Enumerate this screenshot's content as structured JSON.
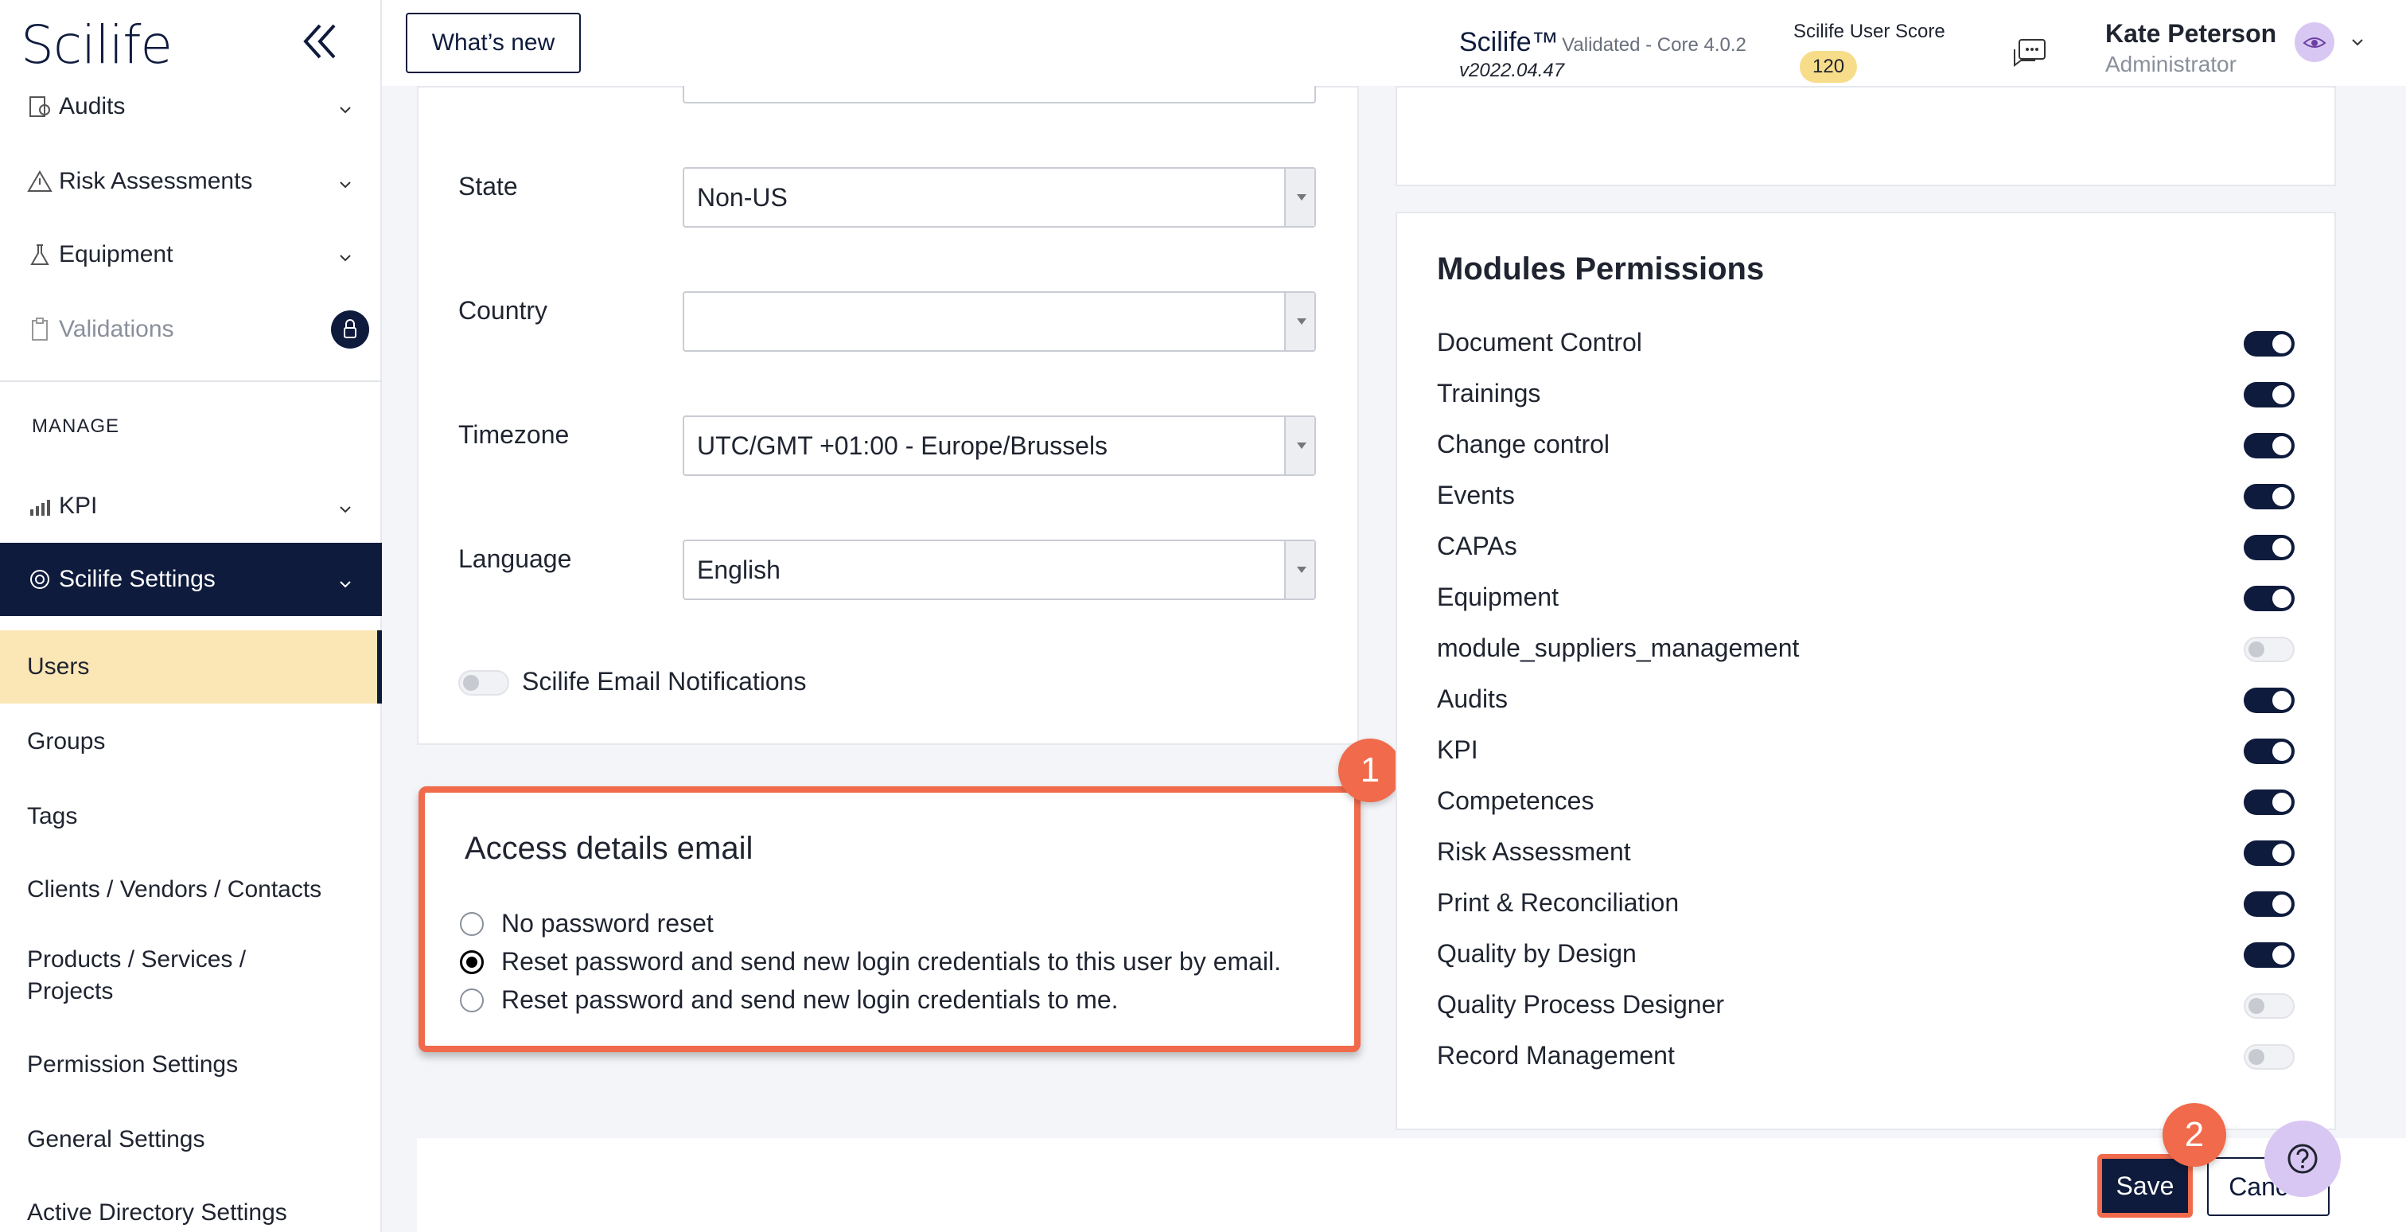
{
  "app": {
    "logo": "Scilife"
  },
  "sidebar": {
    "items": [
      {
        "label": "Audits"
      },
      {
        "label": "Risk Assessments"
      },
      {
        "label": "Equipment"
      },
      {
        "label": "Validations"
      }
    ],
    "section_manage": "MANAGE",
    "kpi": "KPI",
    "settings": "Scilife Settings",
    "sub_items": [
      {
        "label": "Users"
      },
      {
        "label": "Groups"
      },
      {
        "label": "Tags"
      },
      {
        "label": "Clients / Vendors / Contacts"
      },
      {
        "label": "Products / Services /",
        "label2": "Projects"
      },
      {
        "label": "Permission Settings"
      },
      {
        "label": "General Settings"
      },
      {
        "label": "Active Directory Settings"
      }
    ]
  },
  "header": {
    "whats_new": "What’s new",
    "brand": "Scilife™",
    "validated": "Validated - Core 4.0.2",
    "version": "v2022.04.47",
    "score_label": "Scilife User Score",
    "score_value": "120",
    "user_name": "Kate Peterson",
    "user_role": "Administrator"
  },
  "form": {
    "state_label": "State",
    "state_value": "Non-US",
    "country_label": "Country",
    "country_value": "",
    "timezone_label": "Timezone",
    "timezone_value": "UTC/GMT +01:00 - Europe/Brussels",
    "language_label": "Language",
    "language_value": "English",
    "email_notifications_label": "Scilife Email Notifications"
  },
  "access": {
    "title": "Access details email",
    "options": [
      "No password reset",
      "Reset password and send new login credentials to this user by email.",
      "Reset password and send new login credentials to me."
    ],
    "selected_index": 1
  },
  "permissions": {
    "title": "Modules Permissions",
    "modules": [
      {
        "label": "Document Control",
        "enabled": true
      },
      {
        "label": "Trainings",
        "enabled": true
      },
      {
        "label": "Change control",
        "enabled": true
      },
      {
        "label": "Events",
        "enabled": true
      },
      {
        "label": "CAPAs",
        "enabled": true
      },
      {
        "label": "Equipment",
        "enabled": true
      },
      {
        "label": "module_suppliers_management",
        "enabled": false
      },
      {
        "label": "Audits",
        "enabled": true
      },
      {
        "label": "KPI",
        "enabled": true
      },
      {
        "label": "Competences",
        "enabled": true
      },
      {
        "label": "Risk Assessment",
        "enabled": true
      },
      {
        "label": "Print & Reconciliation",
        "enabled": true
      },
      {
        "label": "Quality by Design",
        "enabled": true
      },
      {
        "label": "Quality Process Designer",
        "enabled": false
      },
      {
        "label": "Record Management",
        "enabled": false
      }
    ]
  },
  "actions": {
    "save": "Save",
    "cancel": "Cancel"
  },
  "callouts": {
    "one": "1",
    "two": "2"
  },
  "colors": {
    "navy": "#0f1b3d",
    "highlight": "#f06a4b",
    "selected_bg": "#fbe7b6"
  }
}
